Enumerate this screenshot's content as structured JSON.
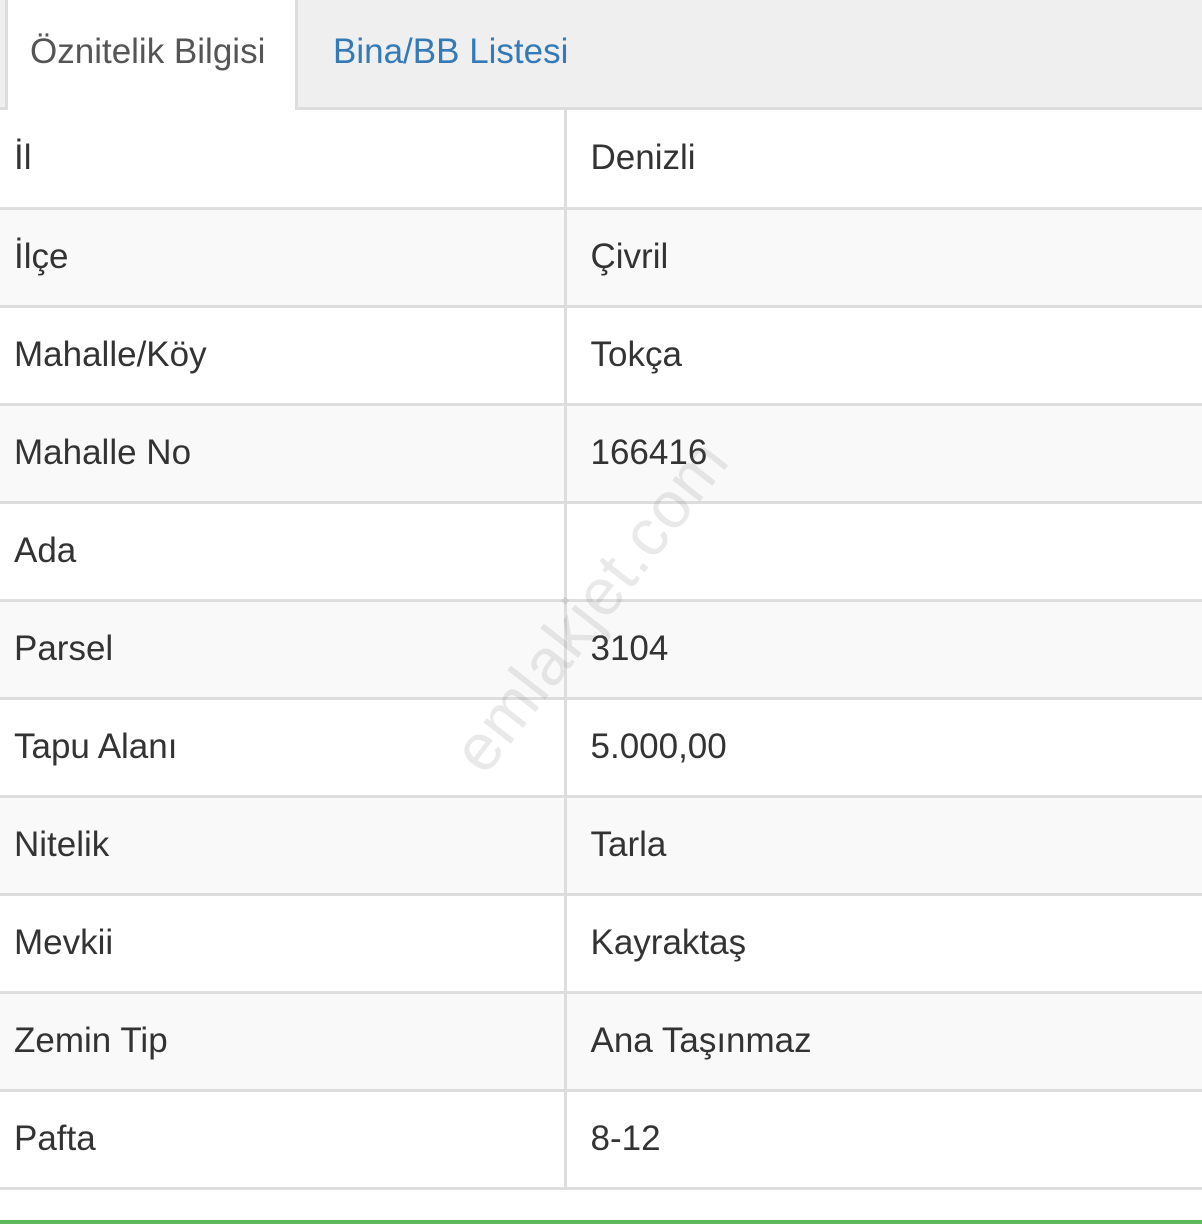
{
  "tabs": [
    {
      "label": "Öznitelik Bilgisi",
      "active": true
    },
    {
      "label": "Bina/BB Listesi",
      "active": false
    }
  ],
  "rows": [
    {
      "key": "İl",
      "value": "Denizli"
    },
    {
      "key": "İlçe",
      "value": "Çivril"
    },
    {
      "key": "Mahalle/Köy",
      "value": "Tokça"
    },
    {
      "key": "Mahalle No",
      "value": "166416"
    },
    {
      "key": "Ada",
      "value": ""
    },
    {
      "key": "Parsel",
      "value": "3104"
    },
    {
      "key": "Tapu Alanı",
      "value": "5.000,00"
    },
    {
      "key": "Nitelik",
      "value": "Tarla"
    },
    {
      "key": "Mevkii",
      "value": "Kayraktaş"
    },
    {
      "key": "Zemin Tip",
      "value": "Ana Taşınmaz"
    },
    {
      "key": "Pafta",
      "value": "8-12"
    }
  ],
  "watermark": "emlakjet.com",
  "colors": {
    "link": "#337ab7",
    "border": "#dddddd",
    "accent": "#5cb85c"
  }
}
